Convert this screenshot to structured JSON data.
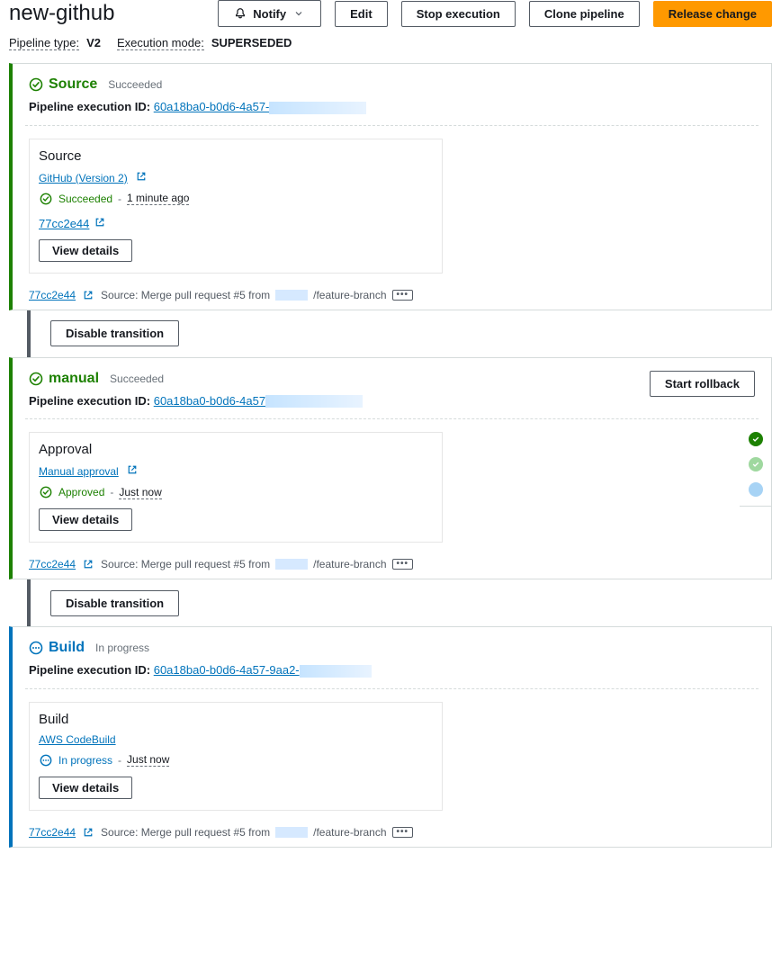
{
  "header": {
    "title": "new-github",
    "notify": "Notify",
    "edit": "Edit",
    "stop": "Stop execution",
    "clone": "Clone pipeline",
    "release": "Release change"
  },
  "meta": {
    "pipeline_type_label": "Pipeline type:",
    "pipeline_type_value": "V2",
    "exec_mode_label": "Execution mode:",
    "exec_mode_value": "SUPERSEDED"
  },
  "exec_id_label": "Pipeline execution ID:",
  "view_details": "View details",
  "disable_transition": "Disable transition",
  "commit": {
    "hash": "77cc2e44",
    "prefix": "Source: Merge pull request #5 from",
    "suffix": "/feature-branch",
    "more": "•••"
  },
  "stages": [
    {
      "name": "Source",
      "status": "success",
      "status_text": "Succeeded",
      "exec_id": "60a18ba0-b0d6-4a57-",
      "mask_w": 108,
      "action": {
        "name": "Source",
        "provider": "GitHub (Version 2)",
        "status_text": "Succeeded",
        "status": "success",
        "timestamp": "1 minute ago",
        "commit": "77cc2e44"
      }
    },
    {
      "name": "manual",
      "status": "success",
      "status_text": "Succeeded",
      "exec_id": "60a18ba0-b0d6-4a57",
      "mask_w": 108,
      "rollback": "Start rollback",
      "action": {
        "name": "Approval",
        "provider": "Manual approval",
        "status_text": "Approved",
        "status": "success",
        "timestamp": "Just now"
      }
    },
    {
      "name": "Build",
      "status": "inprogress",
      "status_text": "In progress",
      "exec_id": "60a18ba0-b0d6-4a57-9aa2-",
      "mask_w": 80,
      "action": {
        "name": "Build",
        "provider": "AWS CodeBuild",
        "status_text": "In progress",
        "status": "inprogress",
        "timestamp": "Just now"
      }
    }
  ]
}
